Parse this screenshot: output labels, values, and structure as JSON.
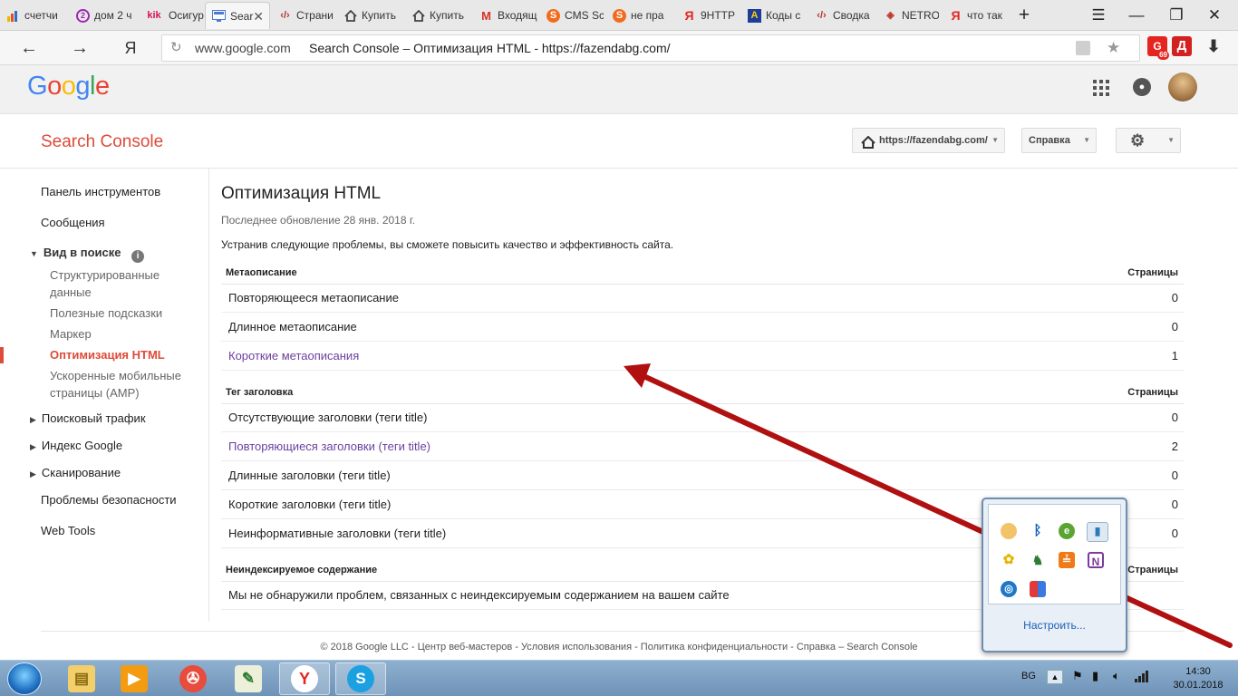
{
  "browser": {
    "tabs": [
      {
        "label": "счетчи",
        "icon": "bar-chart-icon",
        "color": "#f0b400"
      },
      {
        "label": "дом 2 ч",
        "icon": "purple-circle-icon",
        "color": "#9c27b0"
      },
      {
        "label": "Осигур",
        "icon": "kik-icon",
        "color": "#d4145a"
      },
      {
        "label": "Sear",
        "icon": "search-console-icon",
        "color": "#4a7bd0",
        "active": true
      },
      {
        "label": "Страни",
        "icon": "code-icon",
        "color": "#b03030"
      },
      {
        "label": "Купить",
        "icon": "house-icon",
        "color": "#444444"
      },
      {
        "label": "Купить",
        "icon": "house-icon",
        "color": "#444444"
      },
      {
        "label": "Входящ",
        "icon": "gmail-icon",
        "color": "#d93025"
      },
      {
        "label": "CMS Sc",
        "icon": "orange-s-icon",
        "color": "#f26b1d"
      },
      {
        "label": "не пра",
        "icon": "orange-s-icon",
        "color": "#f26b1d"
      },
      {
        "label": "9HTTP",
        "icon": "yandex-icon",
        "color": "#e52620"
      },
      {
        "label": "Коды с",
        "icon": "blue-a-icon",
        "color": "#1e3c99"
      },
      {
        "label": "Сводка",
        "icon": "code-icon",
        "color": "#b03030"
      },
      {
        "label": "NETRO",
        "icon": "diamond-icon",
        "color": "#c0392b"
      },
      {
        "label": "что так",
        "icon": "yandex-icon",
        "color": "#e52620"
      }
    ],
    "yandex_label": "Я",
    "url_domain": "www.google.com",
    "page_title": "Search Console – Оптимизация HTML - https://fazendabg.com/",
    "badge_count": "69",
    "ext_d_label": "Д"
  },
  "google": {
    "logo": "Google",
    "logo_colors": [
      "#4285f4",
      "#ea4335",
      "#fbbc05",
      "#4285f4",
      "#34a853",
      "#ea4335"
    ]
  },
  "console": {
    "title": "Search Console",
    "site_button": "https://fazendabg.com/",
    "help_button": "Справка"
  },
  "sidebar": {
    "items": [
      {
        "label": "Панель инструментов"
      },
      {
        "label": "Сообщения"
      },
      {
        "label": "Вид в поиске"
      },
      {
        "label": "Структурированные данные"
      },
      {
        "label": "Полезные подсказки"
      },
      {
        "label": "Маркер"
      },
      {
        "label": "Оптимизация HTML"
      },
      {
        "label": "Ускоренные мобильные страницы (AMP)"
      },
      {
        "label": "Поисковый трафик"
      },
      {
        "label": "Индекс Google"
      },
      {
        "label": "Сканирование"
      },
      {
        "label": "Проблемы безопасности"
      },
      {
        "label": "Web Tools"
      }
    ]
  },
  "main": {
    "heading": "Оптимизация HTML",
    "updated": "Последнее обновление 28 янв. 2018 г.",
    "intro": "Устранив следующие проблемы, вы сможете повысить качество и эффективность сайта.",
    "sections": [
      {
        "title": "Метаописание",
        "pages_label": "Страницы",
        "rows": [
          {
            "label": "Повторяющееся метаописание",
            "count": "0",
            "link": false
          },
          {
            "label": "Длинное метаописание",
            "count": "0",
            "link": false
          },
          {
            "label": "Короткие метаописания",
            "count": "1",
            "link": true
          }
        ]
      },
      {
        "title": "Тег заголовка",
        "pages_label": "Страницы",
        "rows": [
          {
            "label": "Отсутствующие заголовки (теги title)",
            "count": "0",
            "link": false
          },
          {
            "label": "Повторяющиеся заголовки (теги title)",
            "count": "2",
            "link": true
          },
          {
            "label": "Длинные заголовки (теги title)",
            "count": "0",
            "link": false
          },
          {
            "label": "Короткие заголовки (теги title)",
            "count": "0",
            "link": false
          },
          {
            "label": "Неинформативные заголовки (теги title)",
            "count": "0",
            "link": false
          }
        ]
      },
      {
        "title": "Неиндексируемое содержание",
        "pages_label": "Страницы",
        "message": "Мы не обнаружили проблем, связанных с неиндексируемым содержанием на вашем сайте"
      }
    ]
  },
  "footer": {
    "text": "© 2018 Google LLC - Центр веб-мастеров - Условия использования - Политика конфиденциальности - Справка – Search Console"
  },
  "tray_popup": {
    "customize": "Настроить..."
  },
  "taskbar": {
    "lang": "BG",
    "time": "14:30",
    "date": "30.01.2018"
  },
  "annotation": {
    "arrow_color": "#b01010"
  }
}
